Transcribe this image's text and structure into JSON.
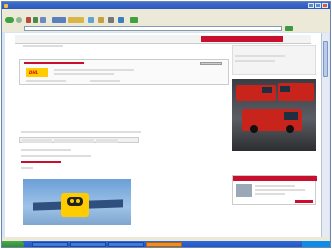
{
  "window": {
    "title": ""
  },
  "menu": {
    "items": [
      "",
      "",
      "",
      "",
      "",
      ""
    ]
  },
  "address": {
    "url": ""
  },
  "links_label": "",
  "site": {
    "brand_color": "#c8102e",
    "dhl_logo_text": "DHL",
    "nav_tabs": [
      "",
      ""
    ]
  },
  "status": {
    "text": ""
  },
  "taskbar": {
    "start_label": "",
    "clock": "",
    "tasks": [
      "",
      "",
      "",
      ""
    ]
  },
  "colors": {
    "dhl_yellow": "#ffcc00",
    "dhl_red": "#d40511",
    "xp_blue": "#2a56b8"
  }
}
